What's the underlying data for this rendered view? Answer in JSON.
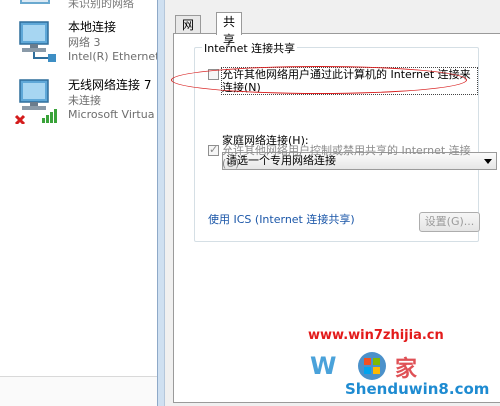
{
  "network_list": {
    "top_partial_text": "未识别的网络",
    "connections": [
      {
        "name": "本地连接",
        "line2": "网络 3",
        "line3": "Intel(R) Ethernet"
      },
      {
        "name": "无线网络连接 7",
        "line2": "未连接",
        "line3": "Microsoft Virtua"
      }
    ]
  },
  "dialog": {
    "tabs": [
      {
        "label": "网络",
        "active": false
      },
      {
        "label": "共享",
        "active": true
      }
    ],
    "group_title": "Internet 连接共享",
    "allow_connect": {
      "checked": false,
      "label": "允许其他网络用户通过此计算机的 Internet 连接来连接(N)"
    },
    "home_network_label": "家庭网络连接(H):",
    "home_network_select": {
      "value": "请选一个专用网络连接"
    },
    "allow_control": {
      "checked": true,
      "disabled": true,
      "label": "允许其他网络用户控制或禁用共享的 Internet 连接(O)"
    },
    "ics_link": "使用 ICS (Internet 连接共享)",
    "settings_button": "设置(G)..."
  },
  "watermark": {
    "url": "www.win7zhijia.cn",
    "site": "Shenduwin8.com"
  },
  "colors": {
    "annotation": "#d81f1f",
    "link": "#1a56a8",
    "watermark_url": "#e31b1b",
    "watermark_site": "#1e8bd1"
  }
}
